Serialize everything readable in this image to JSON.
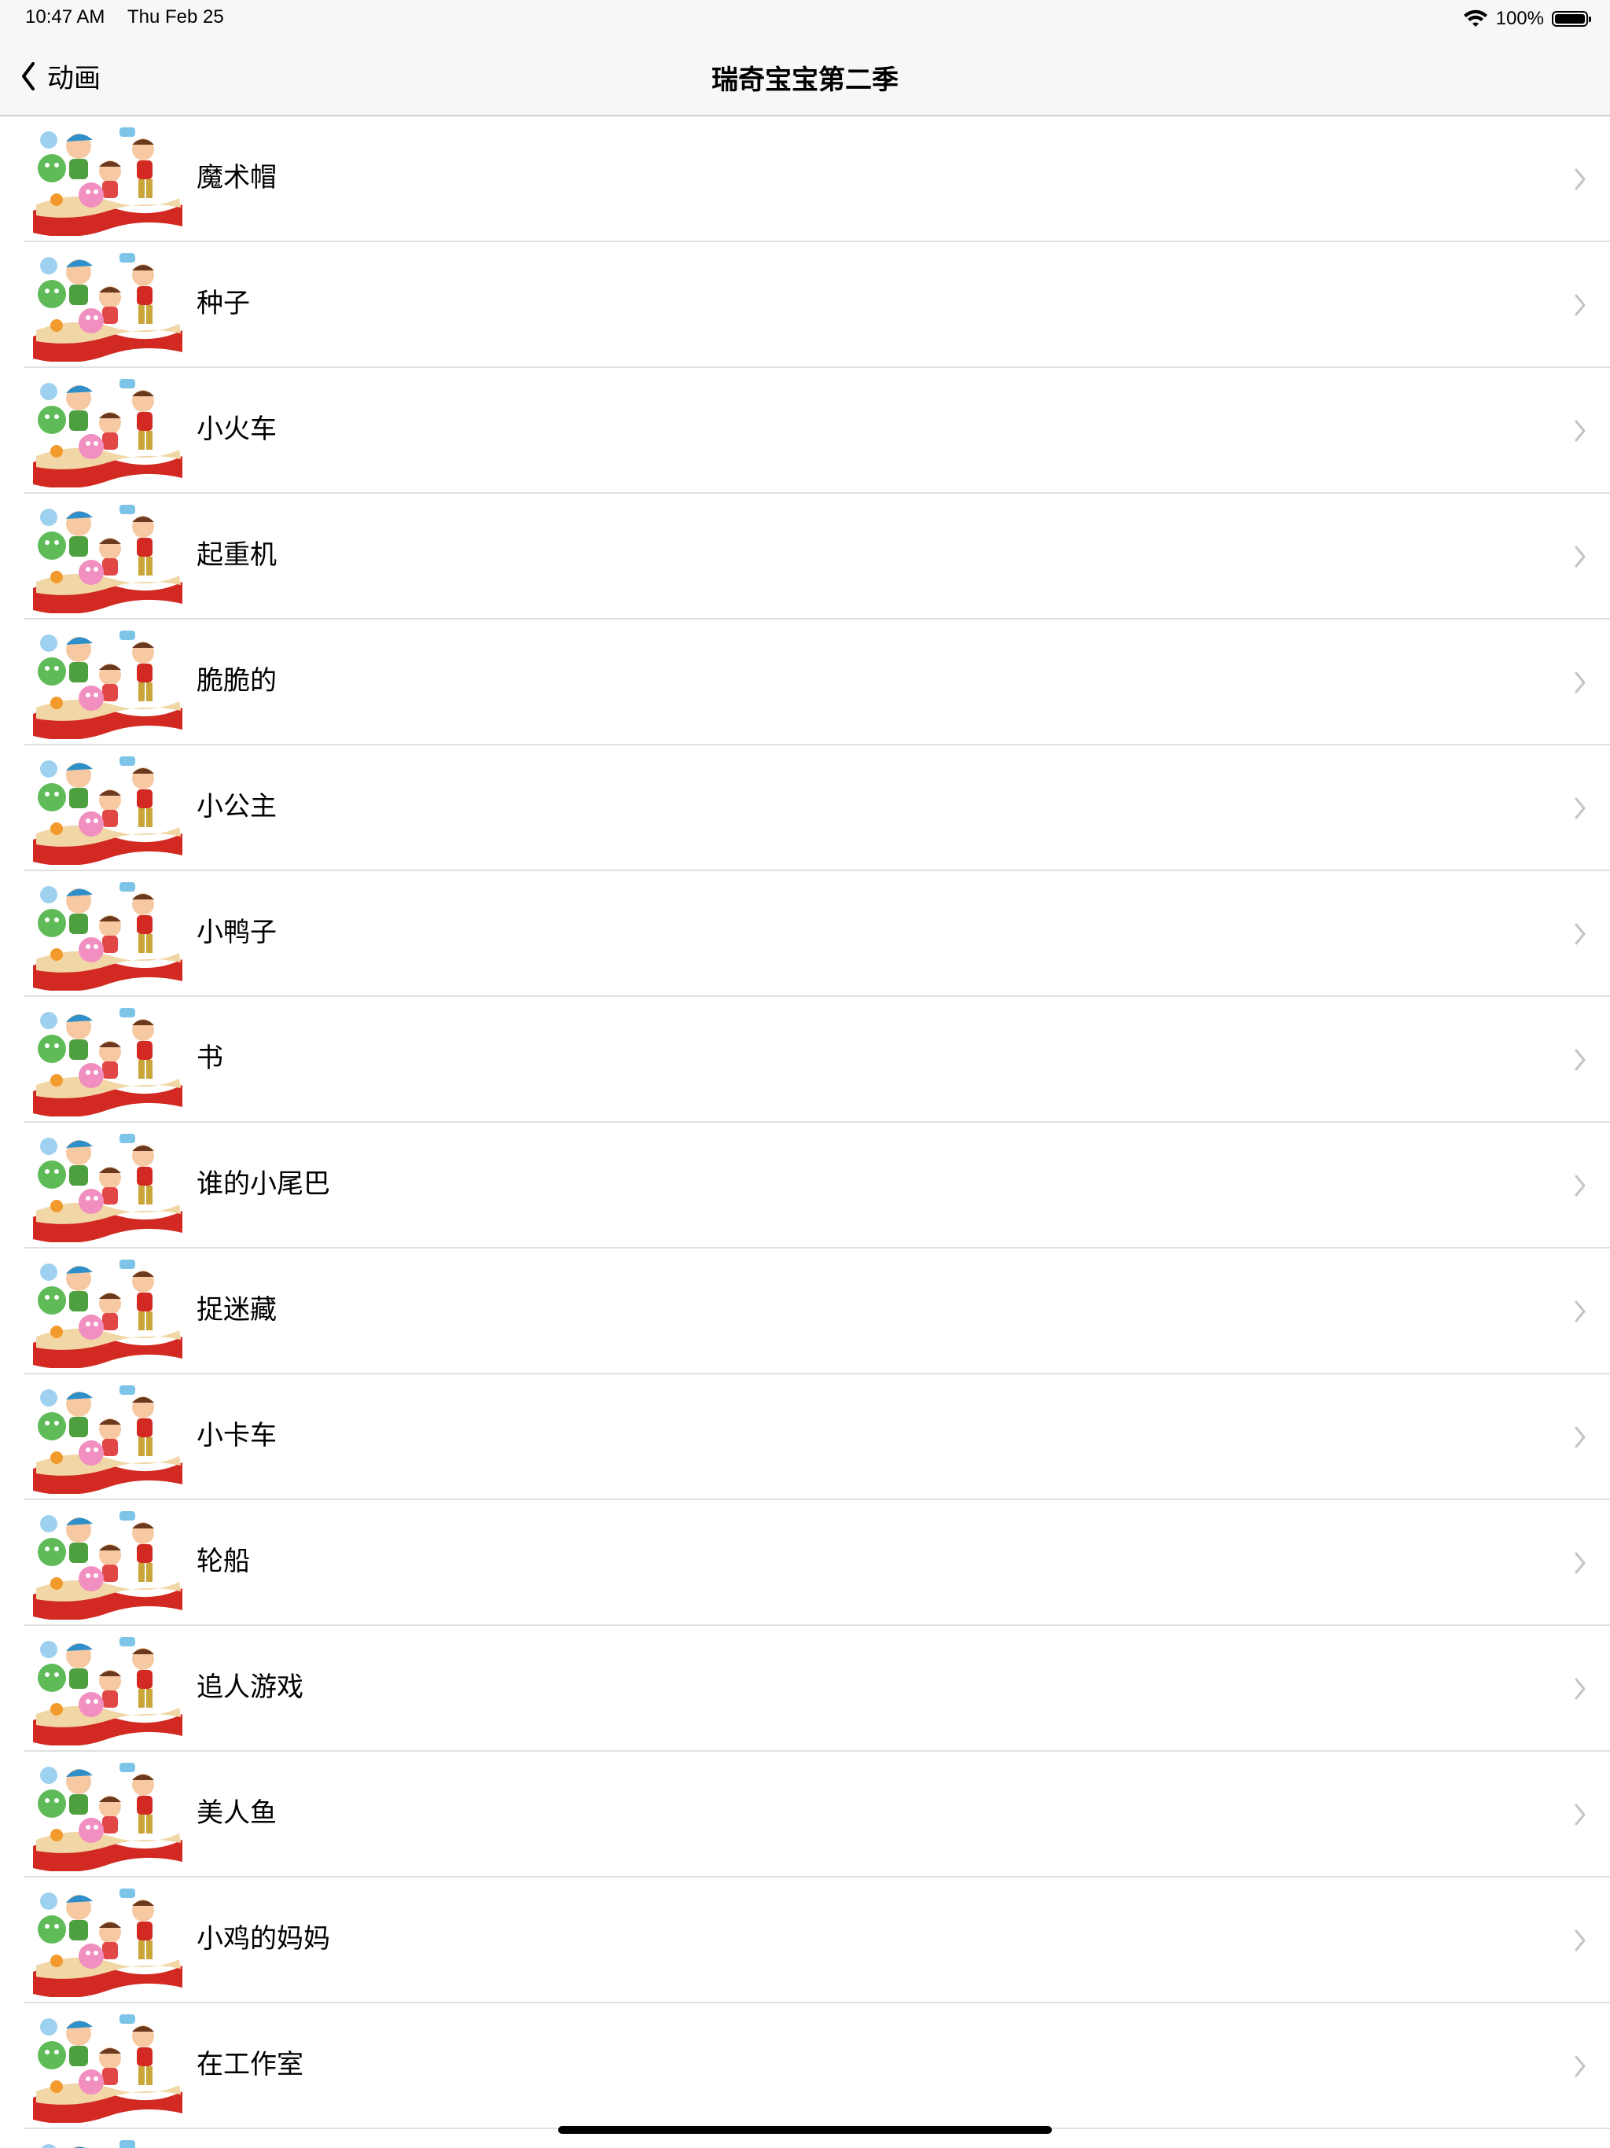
{
  "status_bar": {
    "time": "10:47 AM",
    "date": "Thu Feb 25",
    "battery": "100%",
    "wifi_icon": "wifi-icon",
    "battery_icon": "battery-icon"
  },
  "nav": {
    "back_label": "动画",
    "title": "瑞奇宝宝第二季"
  },
  "episodes": [
    "魔术帽",
    "种子",
    "小火车",
    "起重机",
    "脆脆的",
    "小公主",
    "小鸭子",
    "书",
    "谁的小尾巴",
    "捉迷藏",
    "小卡车",
    "轮船",
    "追人游戏",
    "美人鱼",
    "小鸡的妈妈",
    "在工作室",
    ""
  ]
}
